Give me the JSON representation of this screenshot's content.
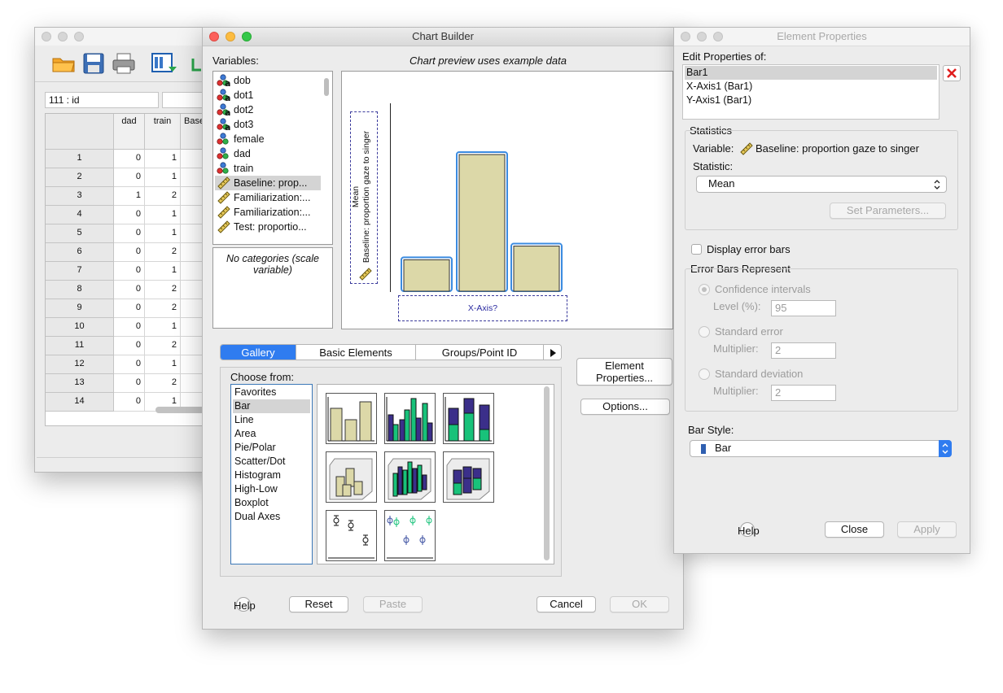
{
  "data_editor": {
    "cell_ref": "111 : id",
    "columns": [
      "dad",
      "train",
      "Base"
    ],
    "rows": [
      {
        "n": "1",
        "dad": "0",
        "train": "1"
      },
      {
        "n": "2",
        "dad": "0",
        "train": "1"
      },
      {
        "n": "3",
        "dad": "1",
        "train": "2"
      },
      {
        "n": "4",
        "dad": "0",
        "train": "1"
      },
      {
        "n": "5",
        "dad": "0",
        "train": "1"
      },
      {
        "n": "6",
        "dad": "0",
        "train": "2"
      },
      {
        "n": "7",
        "dad": "0",
        "train": "1"
      },
      {
        "n": "8",
        "dad": "0",
        "train": "2"
      },
      {
        "n": "9",
        "dad": "0",
        "train": "2"
      },
      {
        "n": "10",
        "dad": "0",
        "train": "1"
      },
      {
        "n": "11",
        "dad": "0",
        "train": "2"
      },
      {
        "n": "12",
        "dad": "0",
        "train": "1"
      },
      {
        "n": "13",
        "dad": "0",
        "train": "2"
      },
      {
        "n": "14",
        "dad": "0",
        "train": "1"
      }
    ]
  },
  "chart_builder": {
    "title": "Chart Builder",
    "variables_label": "Variables:",
    "preview_note": "Chart preview uses example data",
    "variables": [
      {
        "label": "dob",
        "icon": "nominal-string-icon"
      },
      {
        "label": "dot1",
        "icon": "nominal-string-icon"
      },
      {
        "label": "dot2",
        "icon": "nominal-string-icon"
      },
      {
        "label": "dot3",
        "icon": "nominal-string-icon"
      },
      {
        "label": "female",
        "icon": "nominal-icon"
      },
      {
        "label": "dad",
        "icon": "nominal-icon"
      },
      {
        "label": "train",
        "icon": "nominal-icon"
      },
      {
        "label": "Baseline: prop...",
        "icon": "scale-ruler-icon"
      },
      {
        "label": "Familiarization:...",
        "icon": "scale-ruler-icon"
      },
      {
        "label": "Familiarization:...",
        "icon": "scale-ruler-icon"
      },
      {
        "label": "Test: proportio...",
        "icon": "scale-ruler-icon"
      }
    ],
    "categories_note": "No categories (scale variable)",
    "preview": {
      "y_axis_label_line1": "Mean",
      "y_axis_label_line2": "Baseline: proportion gaze to singer",
      "x_axis_label": "X-Axis?",
      "example_bar_heights": [
        0.23,
        1.0,
        0.33
      ]
    },
    "tabs": [
      "Gallery",
      "Basic Elements",
      "Groups/Point ID"
    ],
    "element_properties_btn": "Element Properties...",
    "options_btn": "Options...",
    "choose_from_label": "Choose from:",
    "chart_types": [
      "Favorites",
      "Bar",
      "Line",
      "Area",
      "Pie/Polar",
      "Scatter/Dot",
      "Histogram",
      "High-Low",
      "Boxplot",
      "Dual Axes"
    ],
    "selected_chart_type": "Bar",
    "buttons": {
      "help": "Help",
      "reset": "Reset",
      "paste": "Paste",
      "cancel": "Cancel",
      "ok": "OK"
    },
    "colors": {
      "bar_fill": "#dcd8a8",
      "selection_blue": "#3b8be0",
      "tab_active": "#2f7cf0"
    }
  },
  "element_properties": {
    "title": "Element Properties",
    "edit_label": "Edit Properties of:",
    "elements": [
      "Bar1",
      "X-Axis1 (Bar1)",
      "Y-Axis1 (Bar1)"
    ],
    "statistics_group": "Statistics",
    "variable_label": "Variable:",
    "variable_value": "Baseline: proportion gaze to singer",
    "statistic_label": "Statistic:",
    "statistic_value": "Mean",
    "set_parameters_btn": "Set Parameters...",
    "display_error_bars": "Display error bars",
    "error_bars_group": "Error Bars Represent",
    "ci_label": "Confidence intervals",
    "level_label": "Level (%):",
    "level_value": "95",
    "se_label": "Standard error",
    "multiplier_label": "Multiplier:",
    "se_multiplier": "2",
    "sd_label": "Standard deviation",
    "sd_multiplier": "2",
    "bar_style_label": "Bar Style:",
    "bar_style_value": "Bar",
    "buttons": {
      "help": "Help",
      "close": "Close",
      "apply": "Apply"
    }
  }
}
